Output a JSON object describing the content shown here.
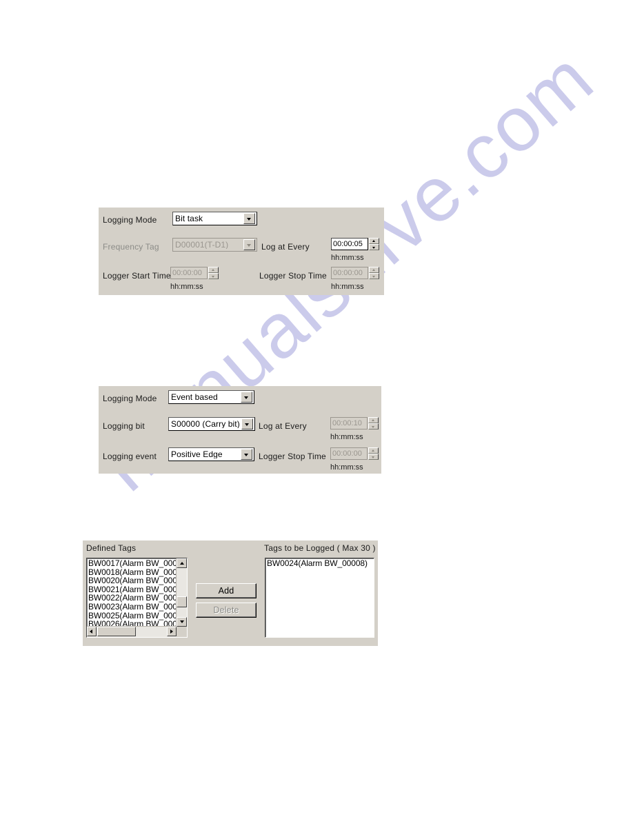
{
  "page": {
    "watermark": "manualshive.com",
    "background": "#ffffff",
    "panel_background": "#d4d0c8"
  },
  "panel_bit_task": {
    "logging_mode_label": "Logging Mode",
    "logging_mode_value": "Bit task",
    "frequency_tag_label": "Frequency Tag",
    "frequency_tag_value": "D00001(T-D1)",
    "log_at_every_label": "Log at Every",
    "log_at_every_value": "00:00:05",
    "log_at_every_hint": "hh:mm:ss",
    "logger_start_time_label": "Logger Start Time",
    "logger_start_time_value": "00:00:00",
    "logger_start_time_hint": "hh:mm:ss",
    "logger_stop_time_label": "Logger Stop Time",
    "logger_stop_time_value": "00:00:00",
    "logger_stop_time_hint": "hh:mm:ss"
  },
  "panel_event_based": {
    "logging_mode_label": "Logging Mode",
    "logging_mode_value": "Event based",
    "logging_bit_label": "Logging bit",
    "logging_bit_value": "S00000 (Carry bit)",
    "logging_event_label": "Logging event",
    "logging_event_value": "Positive Edge",
    "log_at_every_label": "Log at Every",
    "log_at_every_value": "00:00:10",
    "log_at_every_hint": "hh:mm:ss",
    "logger_stop_time_label": "Logger Stop Time",
    "logger_stop_time_value": "00:00:00",
    "logger_stop_time_hint": "hh:mm:ss"
  },
  "panel_tags": {
    "defined_tags_label": "Defined Tags",
    "tags_to_be_logged_label": "Tags to be Logged ( Max 30 )",
    "defined_tags": [
      "BW0017(Alarm BW_000",
      "BW0018(Alarm BW_000",
      "BW0020(Alarm BW_000",
      "BW0021(Alarm BW_000",
      "BW0022(Alarm BW_000",
      "BW0023(Alarm BW_000",
      "BW0025(Alarm BW_000",
      "BW0026(Alarm BW_000"
    ],
    "logged_tags": [
      "BW0024(Alarm BW_00008)"
    ],
    "add_label": "Add",
    "delete_label": "Delete"
  }
}
